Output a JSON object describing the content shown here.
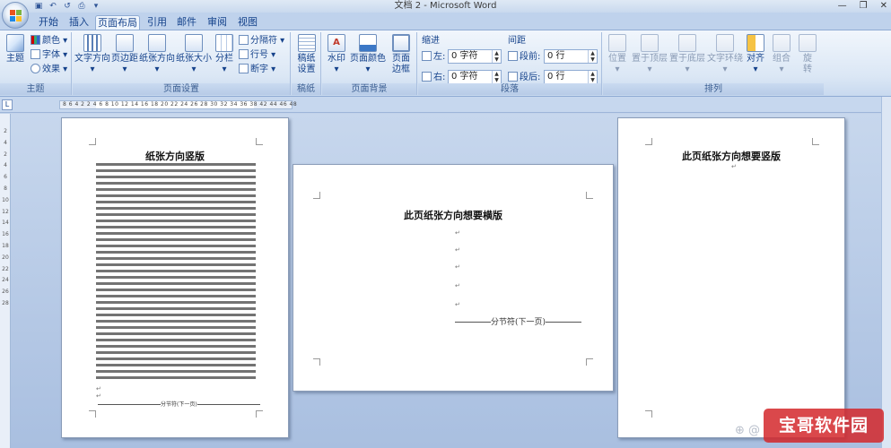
{
  "window": {
    "title": "文档 2 - Microsoft Word",
    "buttons": [
      "—",
      "❐",
      "✕"
    ]
  },
  "qat": {
    "icons": [
      "save-icon",
      "undo-icon",
      "redo-icon",
      "print-icon",
      "customize-icon"
    ],
    "glyphs": [
      "▣",
      "↶",
      "↺",
      "⎙",
      "▾"
    ]
  },
  "tabs": [
    {
      "label": "开始"
    },
    {
      "label": "插入"
    },
    {
      "label": "页面布局",
      "active": true
    },
    {
      "label": "引用"
    },
    {
      "label": "邮件"
    },
    {
      "label": "审阅"
    },
    {
      "label": "视图"
    }
  ],
  "ribbon": {
    "theme": {
      "label": "主题",
      "big": "主题",
      "colors": "颜色",
      "fonts": "字体",
      "effects": "效果"
    },
    "page_setup": {
      "label": "页面设置",
      "text_dir": "文字方向",
      "margins": "页边距",
      "orientation": "纸张方向",
      "size": "纸张大小",
      "columns": "分栏",
      "breaks": "分隔符",
      "line_numbers": "行号",
      "hyphenation": "断字"
    },
    "draft": {
      "label": "稿纸",
      "btn1": "稿纸",
      "btn2": "设置"
    },
    "background": {
      "label": "页面背景",
      "watermark": "水印",
      "page_color": "页面颜色",
      "border1": "页面",
      "border2": "边框"
    },
    "paragraph": {
      "label": "段落",
      "indent": "缩进",
      "spacing": "间距",
      "left_lbl": "左:",
      "left_val": "0 字符",
      "right_lbl": "右:",
      "right_val": "0 字符",
      "before_lbl": "段前:",
      "before_val": "0 行",
      "after_lbl": "段后:",
      "after_val": "0 行"
    },
    "arrange": {
      "label": "排列",
      "position": "位置",
      "front": "置于顶层",
      "back": "置于底层",
      "wrap": "文字环绕",
      "align": "对齐",
      "group": "组合",
      "rotate1": "旋",
      "rotate2": "转"
    }
  },
  "ruler": {
    "tab_glyph": "L",
    "numbers": "8  6  4  2     2  4  6  8  10  12  14  16  18  20  22  24  26  28  30  32  34  36  38       42  44  46  48",
    "vertical": [
      "2",
      "4",
      "2",
      "4",
      "6",
      "8",
      "10",
      "12",
      "14",
      "16",
      "18",
      "20",
      "22",
      "24",
      "26",
      "28"
    ]
  },
  "pages": {
    "page1": {
      "title": "纸张方向竖版",
      "return": "↵",
      "section_break": "分节符(下一页)"
    },
    "page2": {
      "title": "此页纸张方向想要横版",
      "return": "↵",
      "section_break": "分节符(下一页)"
    },
    "page3": {
      "title": "此页纸张方向想要竖版",
      "return": "↵"
    }
  },
  "watermark": {
    "text": "宝哥软件园",
    "logo": "⊕ @"
  }
}
